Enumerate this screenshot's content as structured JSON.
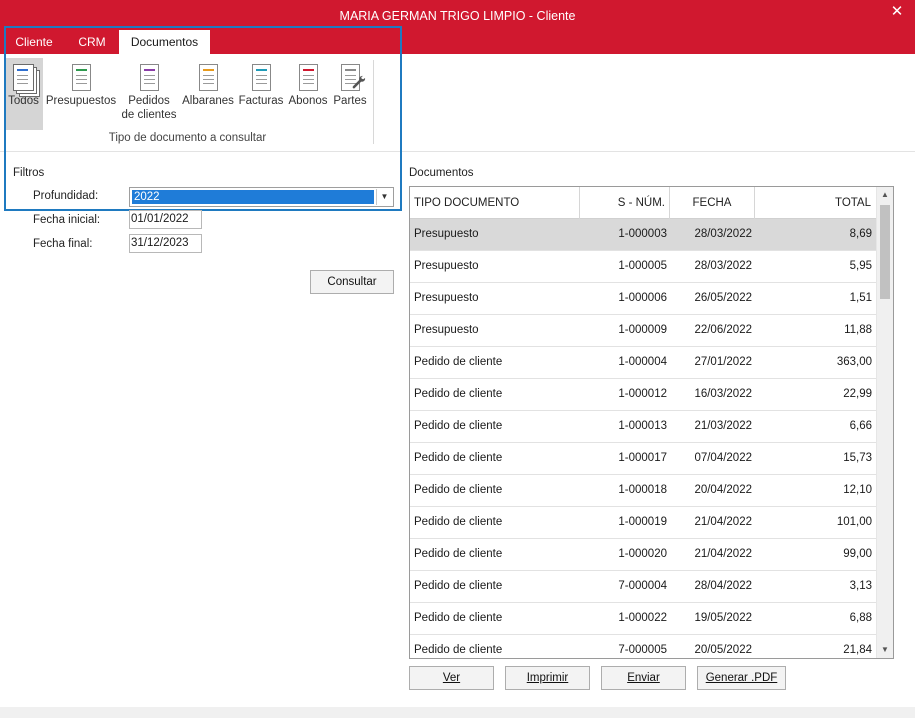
{
  "window": {
    "title": "MARIA GERMAN TRIGO LIMPIO - Cliente",
    "close_label": "✕"
  },
  "tabs": [
    {
      "label": "Cliente"
    },
    {
      "label": "CRM"
    },
    {
      "label": "Documentos",
      "active": true
    }
  ],
  "ribbon": {
    "buttons": [
      {
        "label": "Todos",
        "icon": "stacked-documents-icon",
        "selected": true
      },
      {
        "label": "Presupuestos",
        "icon": "document-green-icon",
        "color": "#2e9a4e"
      },
      {
        "label": "Pedidos\nde clientes",
        "icon": "document-purple-icon",
        "color": "#8b3da8"
      },
      {
        "label": "Albaranes",
        "icon": "document-orange-icon",
        "color": "#e89a1c"
      },
      {
        "label": "Facturas",
        "icon": "document-teal-icon",
        "color": "#1f9bb8"
      },
      {
        "label": "Abonos",
        "icon": "document-red-icon",
        "color": "#d0182f"
      },
      {
        "label": "Partes",
        "icon": "document-wrench-icon",
        "color": "#8a8a8a"
      }
    ],
    "group_caption": "Tipo de documento a consultar"
  },
  "filters": {
    "title": "Filtros",
    "profundidad_label": "Profundidad:",
    "profundidad_value": "2022",
    "fecha_inicial_label": "Fecha inicial:",
    "fecha_inicial_value": "01/01/2022",
    "fecha_final_label": "Fecha final:",
    "fecha_final_value": "31/12/2023",
    "consultar_label": "Consultar"
  },
  "documents": {
    "title": "Documentos",
    "columns": [
      "TIPO DOCUMENTO",
      "S - NÚM.",
      "FECHA",
      "TOTAL"
    ],
    "rows": [
      [
        "Presupuesto",
        "1-000003",
        "28/03/2022",
        "8,69"
      ],
      [
        "Presupuesto",
        "1-000005",
        "28/03/2022",
        "5,95"
      ],
      [
        "Presupuesto",
        "1-000006",
        "26/05/2022",
        "1,51"
      ],
      [
        "Presupuesto",
        "1-000009",
        "22/06/2022",
        "11,88"
      ],
      [
        "Pedido de cliente",
        "1-000004",
        "27/01/2022",
        "363,00"
      ],
      [
        "Pedido de cliente",
        "1-000012",
        "16/03/2022",
        "22,99"
      ],
      [
        "Pedido de cliente",
        "1-000013",
        "21/03/2022",
        "6,66"
      ],
      [
        "Pedido de cliente",
        "1-000017",
        "07/04/2022",
        "15,73"
      ],
      [
        "Pedido de cliente",
        "1-000018",
        "20/04/2022",
        "12,10"
      ],
      [
        "Pedido de cliente",
        "1-000019",
        "21/04/2022",
        "101,00"
      ],
      [
        "Pedido de cliente",
        "1-000020",
        "21/04/2022",
        "99,00"
      ],
      [
        "Pedido de cliente",
        "7-000004",
        "28/04/2022",
        "3,13"
      ],
      [
        "Pedido de cliente",
        "1-000022",
        "19/05/2022",
        "6,88"
      ],
      [
        "Pedido de cliente",
        "7-000005",
        "20/05/2022",
        "21,84"
      ]
    ]
  },
  "actions": {
    "ver": "Ver",
    "imprimir": "Imprimir",
    "enviar": "Enviar",
    "generar_pdf": "Generar .PDF"
  }
}
